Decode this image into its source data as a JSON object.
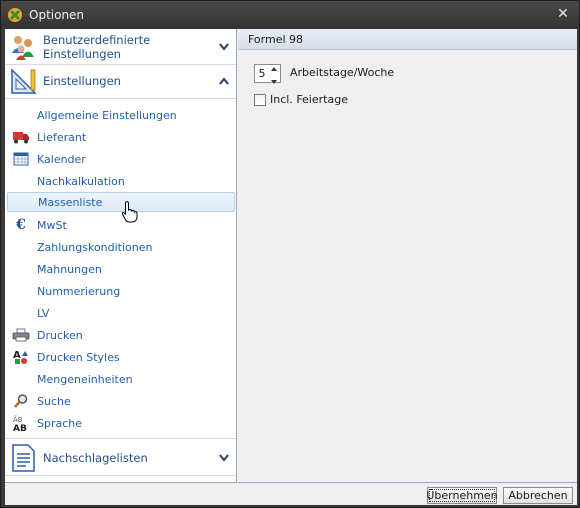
{
  "window": {
    "title": "Optionen",
    "app_icon": "app-logo-icon",
    "close_glyph": "✕"
  },
  "sidebar": {
    "groups": [
      {
        "label": "Benutzerdefinierte Einstellungen",
        "icon": "users-icon",
        "expanded": false
      },
      {
        "label": "Einstellungen",
        "icon": "ruler-triangle-icon",
        "expanded": true
      },
      {
        "label": "Nachschlagelisten",
        "icon": "document-list-icon",
        "expanded": false
      }
    ],
    "items": [
      {
        "label": "Allgemeine Einstellungen",
        "icon": ""
      },
      {
        "label": "Lieferant",
        "icon": "truck-icon"
      },
      {
        "label": "Kalender",
        "icon": "calendar-icon"
      },
      {
        "label": "Nachkalkulation",
        "icon": ""
      },
      {
        "label": "Massenliste",
        "icon": "",
        "selected": true
      },
      {
        "label": "MwSt",
        "icon": "euro-icon"
      },
      {
        "label": "Zahlungskonditionen",
        "icon": ""
      },
      {
        "label": "Mahnungen",
        "icon": ""
      },
      {
        "label": "Nummerierung",
        "icon": ""
      },
      {
        "label": "LV",
        "icon": ""
      },
      {
        "label": "Drucken",
        "icon": "printer-icon"
      },
      {
        "label": "Drucken Styles",
        "icon": "shapes-icon"
      },
      {
        "label": "Mengeneinheiten",
        "icon": ""
      },
      {
        "label": "Suche",
        "icon": "magnifier-icon"
      },
      {
        "label": "Sprache",
        "icon": "language-ab-icon"
      }
    ]
  },
  "panel": {
    "header": "Formel 98",
    "workdays": {
      "value": "5",
      "label": "Arbeitstage/Woche"
    },
    "holidays": {
      "label": "Incl. Feiertage",
      "checked": false
    }
  },
  "footer": {
    "apply_label": "Übernehmen",
    "cancel_label": "Abbrechen"
  },
  "colors": {
    "link": "#1f5fa8",
    "selection": "#dceaf9",
    "titlebar": "#3a3a3a"
  }
}
